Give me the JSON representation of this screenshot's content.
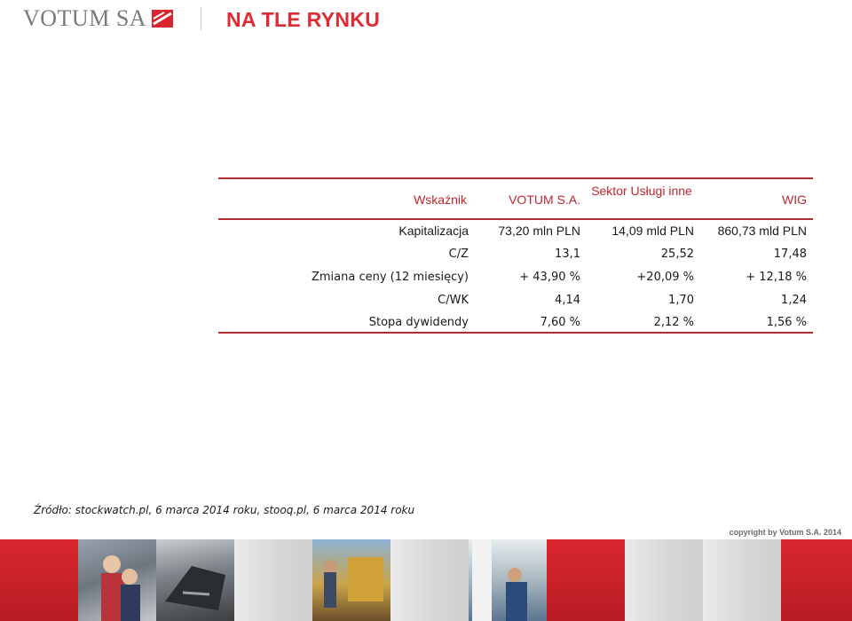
{
  "header": {
    "logo_text": "VOTUM SA",
    "title": "NA TLE RYNKU",
    "brand_color": "#e02a34"
  },
  "table": {
    "columns": [
      "Wskaźnik",
      "VOTUM S.A.",
      "Sektor Usługi inne",
      "WIG"
    ],
    "rows": [
      {
        "label": "Kapitalizacja",
        "votum": "73,20 mln PLN",
        "sektor": "14,09 mld PLN",
        "wig": "860,73 mld PLN"
      },
      {
        "label": "C/Z",
        "votum": "13,1",
        "sektor": "25,52",
        "wig": "17,48"
      },
      {
        "label": "Zmiana ceny (12 miesięcy)",
        "votum": "+ 43,90 %",
        "sektor": "+20,09 %",
        "wig": "+ 12,18 %"
      },
      {
        "label": "C/WK",
        "votum": "4,14",
        "sektor": "1,70",
        "wig": "1,24"
      },
      {
        "label": "Stopa dywidendy",
        "votum": "7,60 %",
        "sektor": "2,12 %",
        "wig": "1,56 %"
      }
    ]
  },
  "source": "Źródło: stockwatch.pl, 6 marca 2014 roku, stooq.pl, 6 marca 2014 roku",
  "copyright": "copyright by Votum S.A. 2014"
}
